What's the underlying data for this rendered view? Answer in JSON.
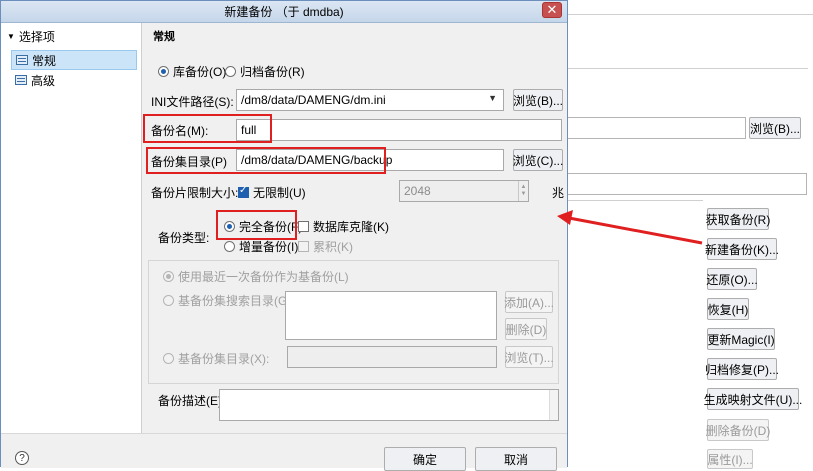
{
  "dialog": {
    "title": "新建备份 （于 dmdba)",
    "close_glyph": "✕",
    "sidebar": {
      "header": "选择项",
      "items": [
        {
          "label": "常规",
          "selected": true
        },
        {
          "label": "高级",
          "selected": false
        }
      ]
    },
    "section_title": "常规",
    "backup_mode": {
      "library_label": "库备份(O)",
      "archive_label": "归档备份(R)",
      "selected": "library"
    },
    "ini_path": {
      "label": "INI文件路径(S):",
      "value": "/dm8/data/DAMENG/dm.ini",
      "browse_label": "浏览(B)..."
    },
    "backup_name": {
      "label": "备份名(M):",
      "value": "full"
    },
    "backup_dir": {
      "label": "备份集目录(P)",
      "value": "/dm8/data/DAMENG/backup",
      "browse_label": "浏览(C)..."
    },
    "piece_size": {
      "label": "备份片限制大小:",
      "unlimited_label": "无限制(U)",
      "unlimited_checked": true,
      "value": "2048",
      "unit": "兆"
    },
    "backup_type": {
      "label": "备份类型:",
      "full_label": "完全备份(F)",
      "incremental_label": "增量备份(I)",
      "selected": "full",
      "clone_label": "数据库克隆(K)",
      "cumulative_label": "累积(K)"
    },
    "incremental_options": {
      "use_last_label": "使用最近一次备份作为基备份(L)",
      "search_dir_label": "基备份集搜索目录(G):",
      "add_label": "添加(A)...",
      "delete_label": "删除(D)",
      "base_dir_label": "基备份集目录(X):",
      "browse_label": "浏览(T)..."
    },
    "description": {
      "label": "备份描述(E):",
      "value": ""
    },
    "footer": {
      "help_glyph": "?",
      "ok_label": "确定",
      "cancel_label": "取消"
    }
  },
  "background_window": {
    "browse_label": "浏览(B)...",
    "buttons": [
      {
        "label": "获取备份(R)",
        "enabled": true
      },
      {
        "label": "新建备份(K)...",
        "enabled": true
      },
      {
        "label": "还原(O)...",
        "enabled": true
      },
      {
        "label": "恢复(H)",
        "enabled": true
      },
      {
        "label": "更新Magic(I)",
        "enabled": true
      },
      {
        "label": "归档修复(P)...",
        "enabled": true
      },
      {
        "label": "生成映射文件(U)...",
        "enabled": true
      },
      {
        "label": "删除备份(D)",
        "enabled": false
      },
      {
        "label": "属性(I)...",
        "enabled": false
      }
    ]
  },
  "annotation": {
    "arrow_color": "#e02020",
    "box_color": "#e02020"
  }
}
